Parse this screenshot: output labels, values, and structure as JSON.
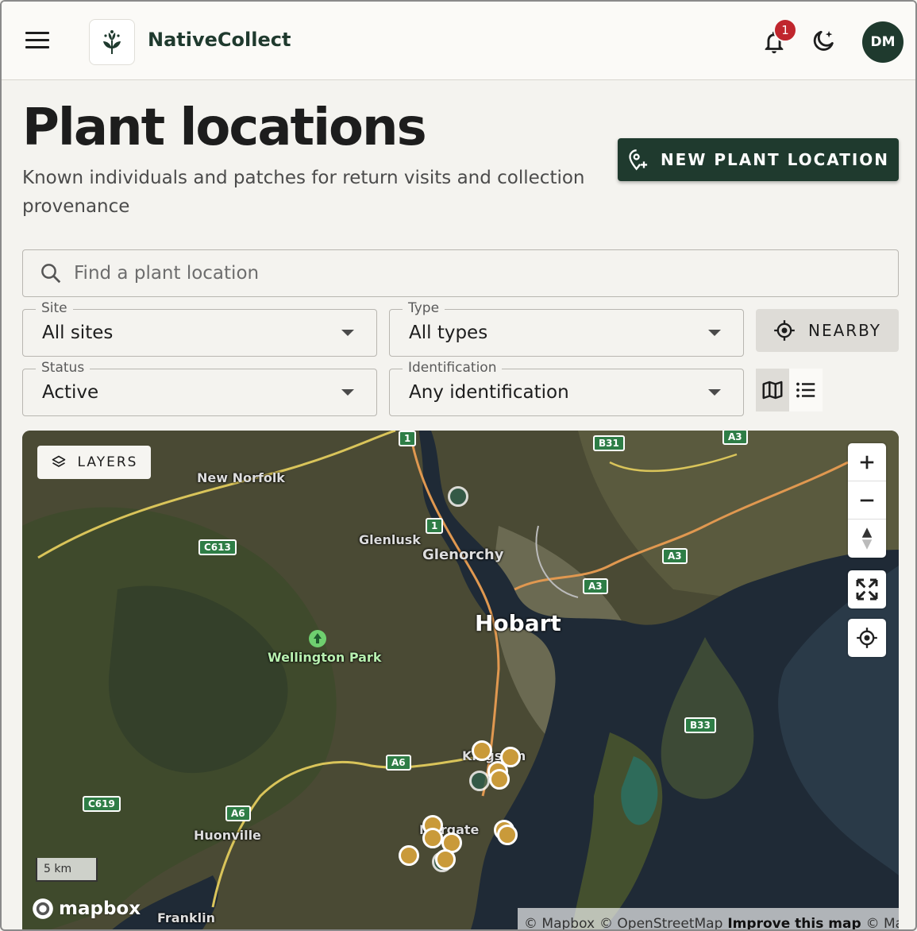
{
  "topbar": {
    "brand": "NativeCollect",
    "notification_count": "1",
    "avatar_initials": "DM"
  },
  "header": {
    "title": "Plant locations",
    "subtitle": "Known individuals and patches for return visits and collection provenance",
    "new_button_label": "NEW PLANT LOCATION"
  },
  "search": {
    "placeholder": "Find a plant location"
  },
  "filters": {
    "site": {
      "label": "Site",
      "value": "All sites"
    },
    "type": {
      "label": "Type",
      "value": "All types"
    },
    "status": {
      "label": "Status",
      "value": "Active"
    },
    "identification": {
      "label": "Identification",
      "value": "Any identification"
    },
    "nearby_label": "NEARBY",
    "view_mode": "map"
  },
  "map": {
    "layers_label": "LAYERS",
    "scale_label": "5 km",
    "mapbox_label": "mapbox",
    "attribution": {
      "mapbox": "© Mapbox",
      "osm": "© OpenStreetMap",
      "improve": "Improve this map",
      "maxar": "© Maxar"
    },
    "places": {
      "new_norfolk": "New Norfolk",
      "glenlusk": "Glenlusk",
      "glenorchy": "Glenorchy",
      "hobart": "Hobart",
      "wellington_park": "Wellington Park",
      "kingston": "Kingston",
      "margate": "Margate",
      "huonville": "Huonville",
      "franklin": "Franklin"
    },
    "roads": {
      "r1a": "1",
      "r1b": "1",
      "b31": "B31",
      "a3a": "A3",
      "c613": "C613",
      "a3b": "A3",
      "a3c": "A3",
      "b33": "B33",
      "a6a": "A6",
      "c619": "C619",
      "a6b": "A6"
    },
    "marker_count": 14
  },
  "colors": {
    "brand_dark_green": "#1f3a2e",
    "badge_red": "#c0262d",
    "marker_gold": "#c99a3a"
  }
}
